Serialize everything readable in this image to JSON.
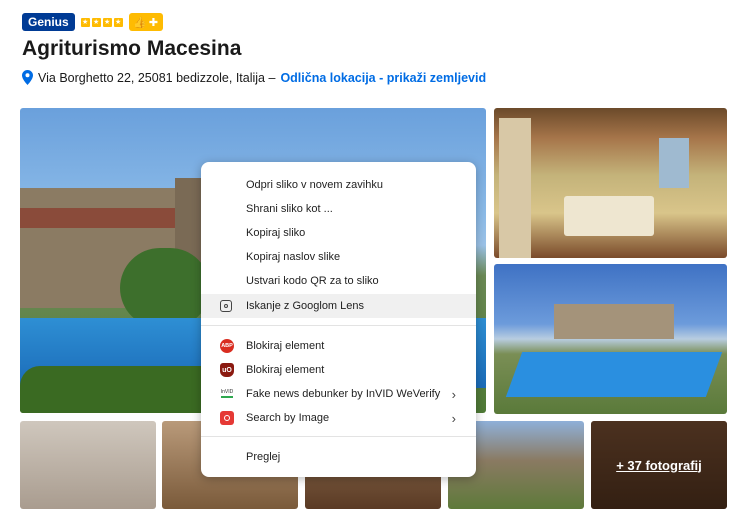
{
  "header": {
    "genius_label": "Genius",
    "star_count": 4,
    "title": "Agriturismo Macesina"
  },
  "address": {
    "text": "Via Borghetto 22, 25081 bedizzole, Italija –",
    "location_link": "Odlična lokacija - prikaži zemljevid"
  },
  "gallery": {
    "more_photos_label": "+ 37 fotografij"
  },
  "context_menu": {
    "items": [
      {
        "label": "Odpri sliko v novem zavihku"
      },
      {
        "label": "Shrani sliko kot ..."
      },
      {
        "label": "Kopiraj sliko"
      },
      {
        "label": "Kopiraj naslov slike"
      },
      {
        "label": "Ustvari kodo QR za to sliko"
      },
      {
        "label": "Iskanje z Googlom Lens"
      },
      {
        "label": "Blokiraj element",
        "icon_text": "ABP"
      },
      {
        "label": "Blokiraj element",
        "icon_text": "uO"
      },
      {
        "label": "Fake news debunker by InVID  WeVerify",
        "icon_text": "InVID"
      },
      {
        "label": "Search by Image"
      },
      {
        "label": "Preglej"
      }
    ]
  },
  "colors": {
    "genius_blue": "#003b95",
    "star_yellow": "#febb02",
    "link_blue": "#006ce4",
    "pin_blue": "#006ce4"
  }
}
